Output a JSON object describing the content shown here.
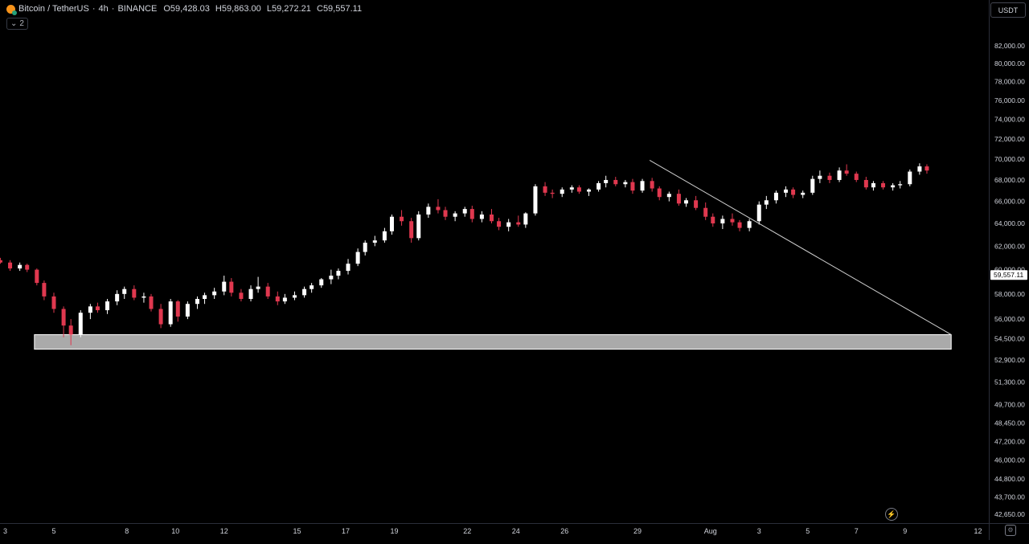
{
  "header": {
    "symbol": "Bitcoin / TetherUS",
    "interval": "4h",
    "exchange": "BINANCE",
    "open_label": "O",
    "open": "59,428.03",
    "high_label": "H",
    "high": "59,863.00",
    "low_label": "L",
    "low": "59,272.21",
    "close_label": "C",
    "close": "59,557.11",
    "indicators_count": "2",
    "currency": "USDT"
  },
  "colors": {
    "up": "#ffffff",
    "down": "#e0384f",
    "background": "#000000",
    "zone": "#c8c8c8",
    "trendline": "#cfcfcf"
  },
  "icons": {
    "coin": "bitcoin-tether-icon",
    "collapse": "chevron-down-icon",
    "settings": "gear-icon",
    "alerts": "bolt-icon"
  },
  "chart_data": {
    "type": "candlestick",
    "symbol": "Bitcoin / TetherUS",
    "timeframe": "4h",
    "y_ticks": [
      "82,000.00",
      "80,000.00",
      "78,000.00",
      "76,000.00",
      "74,000.00",
      "72,000.00",
      "70,000.00",
      "68,000.00",
      "66,000.00",
      "64,000.00",
      "62,000.00",
      "60,000.00",
      "58,000.00",
      "56,000.00",
      "54,500.00",
      "52,900.00",
      "51,300.00",
      "49,700.00",
      "48,450.00",
      "47,200.00",
      "46,000.00",
      "44,800.00",
      "43,700.00",
      "42,650.00"
    ],
    "y_tick_values": [
      82000,
      80000,
      78000,
      76000,
      74000,
      72000,
      70000,
      68000,
      66000,
      64000,
      62000,
      60000,
      58000,
      56000,
      54500,
      52900,
      51300,
      49700,
      48450,
      47200,
      46000,
      44800,
      43700,
      42650
    ],
    "y_scale": "log",
    "x_ticks": [
      "3",
      "5",
      "8",
      "10",
      "12",
      "15",
      "17",
      "19",
      "22",
      "24",
      "26",
      "29",
      "Aug",
      "3",
      "5",
      "7",
      "9",
      "12"
    ],
    "x_tick_days": [
      3,
      5,
      8,
      10,
      12,
      15,
      17,
      19,
      22,
      24,
      26,
      29,
      32,
      34,
      36,
      38,
      40,
      43
    ],
    "last_price": "59,557.11",
    "last_price_value": 59557.11,
    "support_zone": {
      "low": 53700,
      "high": 54800,
      "from_day": 4.2,
      "to_day": 41.9
    },
    "trendline": {
      "start": {
        "day": 29.5,
        "price": 69900
      },
      "end": {
        "day": 41.9,
        "price": 54800
      }
    },
    "candles": [
      [
        2.1,
        61300,
        61700,
        61000,
        61200
      ],
      [
        2.5,
        61200,
        61300,
        60600,
        60800
      ],
      [
        2.8,
        60800,
        61000,
        60500,
        60600
      ],
      [
        3.2,
        60600,
        60800,
        59900,
        60100
      ],
      [
        3.6,
        60100,
        60600,
        59900,
        60400
      ],
      [
        3.9,
        60400,
        60500,
        59800,
        60000
      ],
      [
        4.3,
        60000,
        60100,
        58700,
        58900
      ],
      [
        4.6,
        58900,
        59100,
        57500,
        57800
      ],
      [
        5.0,
        57800,
        58100,
        56500,
        56800
      ],
      [
        5.4,
        56800,
        57000,
        54600,
        55500
      ],
      [
        5.7,
        55500,
        56000,
        54000,
        54800
      ],
      [
        6.1,
        54800,
        56700,
        54600,
        56500
      ],
      [
        6.5,
        56500,
        57200,
        56000,
        57000
      ],
      [
        6.8,
        57000,
        57300,
        56500,
        56700
      ],
      [
        7.2,
        56700,
        57600,
        56400,
        57400
      ],
      [
        7.6,
        57400,
        58300,
        57100,
        58000
      ],
      [
        7.9,
        58000,
        58600,
        57600,
        58400
      ],
      [
        8.3,
        58400,
        58700,
        57500,
        57700
      ],
      [
        8.7,
        57700,
        58100,
        57300,
        57800
      ],
      [
        9.0,
        57800,
        58000,
        56600,
        56800
      ],
      [
        9.4,
        56800,
        57200,
        55300,
        55600
      ],
      [
        9.8,
        55600,
        57600,
        55400,
        57400
      ],
      [
        10.1,
        57400,
        57500,
        55800,
        56200
      ],
      [
        10.5,
        56200,
        57400,
        56000,
        57200
      ],
      [
        10.9,
        57200,
        57800,
        56800,
        57600
      ],
      [
        11.2,
        57600,
        58100,
        57200,
        57900
      ],
      [
        11.6,
        57900,
        58500,
        57600,
        58200
      ],
      [
        12.0,
        58200,
        59500,
        57900,
        59000
      ],
      [
        12.3,
        59000,
        59300,
        57800,
        58100
      ],
      [
        12.7,
        58100,
        58400,
        57400,
        57600
      ],
      [
        13.1,
        57600,
        58700,
        57400,
        58400
      ],
      [
        13.4,
        58400,
        59400,
        58100,
        58600
      ],
      [
        13.8,
        58600,
        58900,
        57600,
        57800
      ],
      [
        14.2,
        57800,
        58200,
        57100,
        57400
      ],
      [
        14.5,
        57400,
        58000,
        57200,
        57700
      ],
      [
        14.9,
        57700,
        58200,
        57500,
        57900
      ],
      [
        15.3,
        57900,
        58600,
        57700,
        58400
      ],
      [
        15.6,
        58400,
        58900,
        58100,
        58700
      ],
      [
        16.0,
        58700,
        59300,
        58500,
        59200
      ],
      [
        16.4,
        59200,
        60000,
        58800,
        59500
      ],
      [
        16.7,
        59500,
        60100,
        59200,
        59900
      ],
      [
        17.1,
        59900,
        60900,
        59600,
        60500
      ],
      [
        17.5,
        60500,
        61800,
        60300,
        61500
      ],
      [
        17.8,
        61500,
        62500,
        61200,
        62300
      ],
      [
        18.2,
        62300,
        62900,
        62000,
        62500
      ],
      [
        18.6,
        62500,
        63600,
        62300,
        63300
      ],
      [
        18.9,
        63300,
        64800,
        63000,
        64600
      ],
      [
        19.3,
        64600,
        65200,
        63800,
        64200
      ],
      [
        19.7,
        64200,
        64500,
        62300,
        62700
      ],
      [
        20.0,
        62700,
        65100,
        62500,
        64800
      ],
      [
        20.4,
        64800,
        65800,
        64500,
        65500
      ],
      [
        20.8,
        65500,
        66200,
        64900,
        65200
      ],
      [
        21.1,
        65200,
        65500,
        64300,
        64600
      ],
      [
        21.5,
        64600,
        65100,
        64200,
        64900
      ],
      [
        21.9,
        64900,
        65500,
        64600,
        65300
      ],
      [
        22.2,
        65300,
        65600,
        64100,
        64400
      ],
      [
        22.6,
        64400,
        65100,
        64100,
        64800
      ],
      [
        23.0,
        64800,
        65300,
        64000,
        64200
      ],
      [
        23.3,
        64200,
        64500,
        63400,
        63700
      ],
      [
        23.7,
        63700,
        64400,
        63300,
        64100
      ],
      [
        24.1,
        64100,
        64700,
        63700,
        63900
      ],
      [
        24.4,
        63900,
        65000,
        63600,
        64900
      ],
      [
        24.8,
        64900,
        67600,
        64700,
        67400
      ],
      [
        25.2,
        67400,
        67800,
        66500,
        66800
      ],
      [
        25.5,
        66800,
        67100,
        66300,
        66700
      ],
      [
        25.9,
        66700,
        67300,
        66400,
        67100
      ],
      [
        26.3,
        67100,
        67500,
        66800,
        67300
      ],
      [
        26.6,
        67300,
        67500,
        66700,
        66900
      ],
      [
        27.0,
        66900,
        67200,
        66500,
        67100
      ],
      [
        27.4,
        67100,
        67900,
        66900,
        67700
      ],
      [
        27.7,
        67700,
        68400,
        67300,
        68000
      ],
      [
        28.1,
        68000,
        68300,
        67400,
        67600
      ],
      [
        28.5,
        67600,
        68000,
        67300,
        67800
      ],
      [
        28.8,
        67800,
        68100,
        66700,
        67000
      ],
      [
        29.2,
        67000,
        68100,
        66800,
        67900
      ],
      [
        29.6,
        67900,
        68200,
        66900,
        67200
      ],
      [
        29.9,
        67200,
        67400,
        66100,
        66400
      ],
      [
        30.3,
        66400,
        66900,
        66000,
        66700
      ],
      [
        30.7,
        66700,
        67100,
        65600,
        65800
      ],
      [
        31.0,
        65800,
        66300,
        65500,
        66100
      ],
      [
        31.4,
        66100,
        66500,
        65200,
        65400
      ],
      [
        31.8,
        65400,
        65900,
        64300,
        64600
      ],
      [
        32.1,
        64600,
        64900,
        63700,
        64000
      ],
      [
        32.5,
        64000,
        64700,
        63500,
        64400
      ],
      [
        32.9,
        64400,
        64900,
        63800,
        64100
      ],
      [
        33.2,
        64100,
        64300,
        63300,
        63600
      ],
      [
        33.6,
        63600,
        64400,
        63300,
        64200
      ],
      [
        34.0,
        64200,
        66000,
        63900,
        65700
      ],
      [
        34.3,
        65700,
        66500,
        65300,
        66100
      ],
      [
        34.7,
        66100,
        67000,
        65800,
        66800
      ],
      [
        35.1,
        66800,
        67400,
        66400,
        67100
      ],
      [
        35.4,
        67100,
        67300,
        66300,
        66600
      ],
      [
        35.8,
        66600,
        67000,
        66300,
        66800
      ],
      [
        36.2,
        66800,
        68400,
        66600,
        68100
      ],
      [
        36.5,
        68100,
        68900,
        67700,
        68400
      ],
      [
        36.9,
        68400,
        68700,
        67700,
        68000
      ],
      [
        37.3,
        68000,
        69200,
        67800,
        68900
      ],
      [
        37.6,
        68900,
        69500,
        68400,
        68600
      ],
      [
        38.0,
        68600,
        68800,
        67800,
        68000
      ],
      [
        38.4,
        68000,
        68300,
        67100,
        67300
      ],
      [
        38.7,
        67300,
        67900,
        67000,
        67700
      ],
      [
        39.1,
        67700,
        67900,
        67100,
        67300
      ],
      [
        39.5,
        67300,
        67700,
        67000,
        67500
      ],
      [
        39.8,
        67500,
        67900,
        67200,
        67600
      ],
      [
        40.2,
        67600,
        69000,
        67400,
        68800
      ],
      [
        40.6,
        68800,
        69600,
        68500,
        69300
      ],
      [
        40.9,
        69300,
        69500,
        68600,
        68900
      ]
    ]
  }
}
